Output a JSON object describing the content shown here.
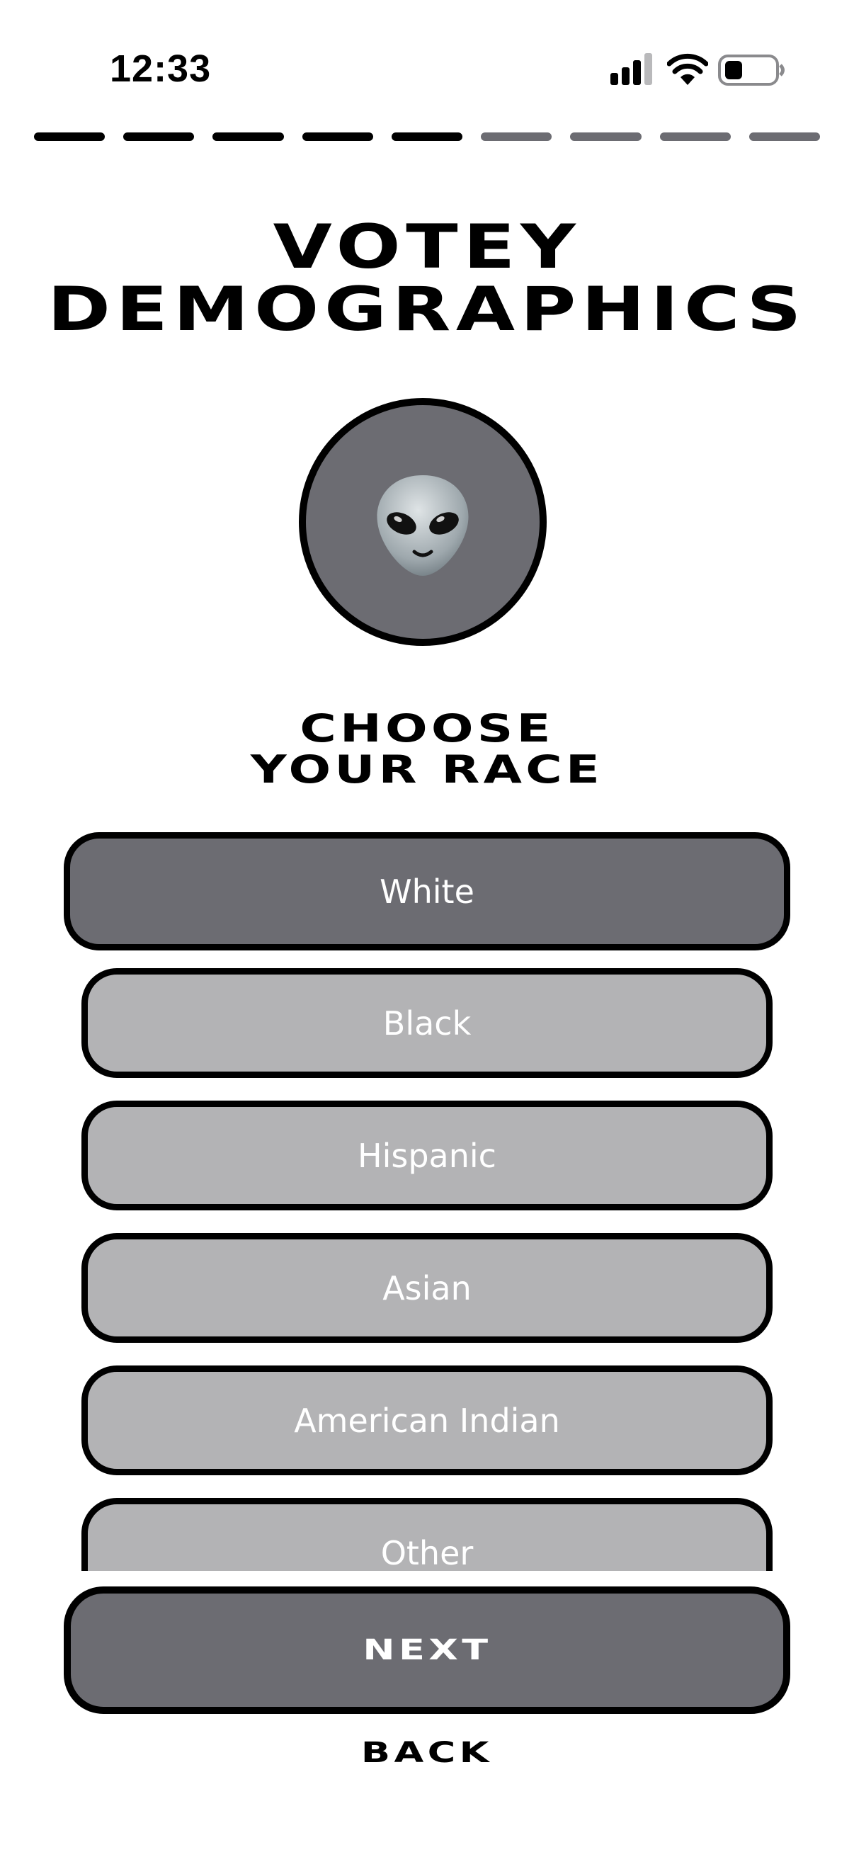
{
  "status_bar": {
    "time": "12:33",
    "icons": [
      "cellular-signal-icon",
      "wifi-icon",
      "battery-icon"
    ]
  },
  "progress": {
    "total_steps": 9,
    "completed_steps": 5
  },
  "title": {
    "line1": "VOTEY",
    "line2": "DEMOGRAPHICS"
  },
  "avatar": {
    "icon": "alien-emoji-icon"
  },
  "prompt": {
    "line1": "CHOOSE",
    "line2": "YOUR RACE"
  },
  "options": [
    {
      "label": "White",
      "selected": true
    },
    {
      "label": "Black",
      "selected": false
    },
    {
      "label": "Hispanic",
      "selected": false
    },
    {
      "label": "Asian",
      "selected": false
    },
    {
      "label": "American Indian",
      "selected": false
    },
    {
      "label": "Other",
      "selected": false
    }
  ],
  "actions": {
    "next_label": "NEXT",
    "back_label": "BACK"
  },
  "colors": {
    "selected_fill": "#6c6c72",
    "unselected_fill": "#b3b3b5",
    "border": "#000000",
    "progress_done": "#000000",
    "progress_pending": "#6c6c72"
  }
}
